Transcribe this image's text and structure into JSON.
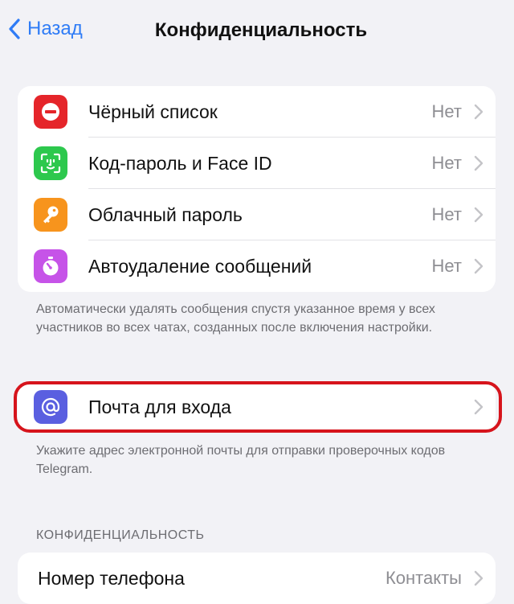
{
  "nav": {
    "back_label": "Назад",
    "title": "Конфиденциальность"
  },
  "security": {
    "items": [
      {
        "label": "Чёрный список",
        "value": "Нет",
        "icon": "block-icon",
        "color": "#e5252a"
      },
      {
        "label": "Код-пароль и Face ID",
        "value": "Нет",
        "icon": "face-id-icon",
        "color": "#2dc84d"
      },
      {
        "label": "Облачный пароль",
        "value": "Нет",
        "icon": "key-icon",
        "color": "#f7941d"
      },
      {
        "label": "Автоудаление сообщений",
        "value": "Нет",
        "icon": "timer-icon",
        "color": "#c653e8"
      }
    ],
    "footer": "Автоматически удалять сообщения спустя указанное время у всех участников во всех чатах, созданных после включения настройки."
  },
  "login_email": {
    "label": "Почта для входа",
    "icon": "at-icon",
    "color": "#5a5fe0",
    "footer": "Укажите адрес электронной почты для отправки проверочных кодов Telegram."
  },
  "privacy": {
    "header": "КОНФИДЕНЦИАЛЬНОСТЬ",
    "items": [
      {
        "label": "Номер телефона",
        "value": "Контакты"
      }
    ]
  },
  "highlight_color": "#d6141c"
}
